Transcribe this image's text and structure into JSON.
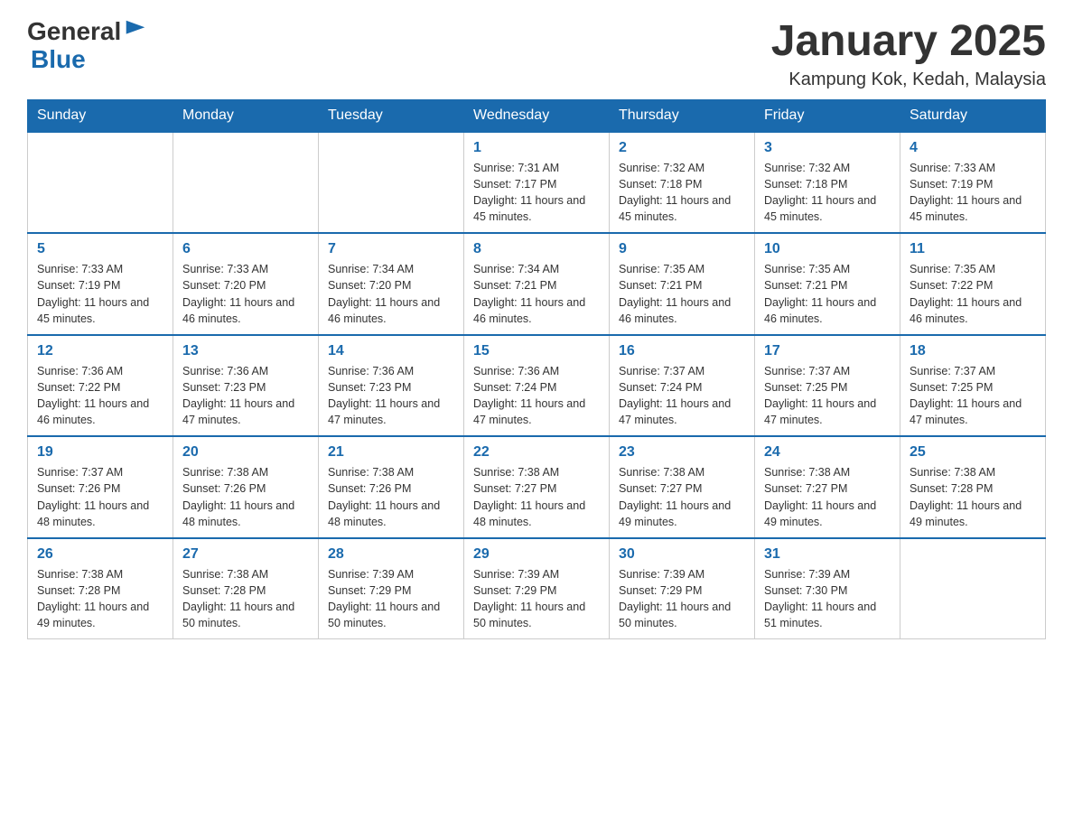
{
  "header": {
    "logo_general": "General",
    "logo_blue": "Blue",
    "month_title": "January 2025",
    "location": "Kampung Kok, Kedah, Malaysia"
  },
  "calendar": {
    "days_of_week": [
      "Sunday",
      "Monday",
      "Tuesday",
      "Wednesday",
      "Thursday",
      "Friday",
      "Saturday"
    ],
    "weeks": [
      [
        {
          "day": "",
          "info": ""
        },
        {
          "day": "",
          "info": ""
        },
        {
          "day": "",
          "info": ""
        },
        {
          "day": "1",
          "info": "Sunrise: 7:31 AM\nSunset: 7:17 PM\nDaylight: 11 hours and 45 minutes."
        },
        {
          "day": "2",
          "info": "Sunrise: 7:32 AM\nSunset: 7:18 PM\nDaylight: 11 hours and 45 minutes."
        },
        {
          "day": "3",
          "info": "Sunrise: 7:32 AM\nSunset: 7:18 PM\nDaylight: 11 hours and 45 minutes."
        },
        {
          "day": "4",
          "info": "Sunrise: 7:33 AM\nSunset: 7:19 PM\nDaylight: 11 hours and 45 minutes."
        }
      ],
      [
        {
          "day": "5",
          "info": "Sunrise: 7:33 AM\nSunset: 7:19 PM\nDaylight: 11 hours and 45 minutes."
        },
        {
          "day": "6",
          "info": "Sunrise: 7:33 AM\nSunset: 7:20 PM\nDaylight: 11 hours and 46 minutes."
        },
        {
          "day": "7",
          "info": "Sunrise: 7:34 AM\nSunset: 7:20 PM\nDaylight: 11 hours and 46 minutes."
        },
        {
          "day": "8",
          "info": "Sunrise: 7:34 AM\nSunset: 7:21 PM\nDaylight: 11 hours and 46 minutes."
        },
        {
          "day": "9",
          "info": "Sunrise: 7:35 AM\nSunset: 7:21 PM\nDaylight: 11 hours and 46 minutes."
        },
        {
          "day": "10",
          "info": "Sunrise: 7:35 AM\nSunset: 7:21 PM\nDaylight: 11 hours and 46 minutes."
        },
        {
          "day": "11",
          "info": "Sunrise: 7:35 AM\nSunset: 7:22 PM\nDaylight: 11 hours and 46 minutes."
        }
      ],
      [
        {
          "day": "12",
          "info": "Sunrise: 7:36 AM\nSunset: 7:22 PM\nDaylight: 11 hours and 46 minutes."
        },
        {
          "day": "13",
          "info": "Sunrise: 7:36 AM\nSunset: 7:23 PM\nDaylight: 11 hours and 47 minutes."
        },
        {
          "day": "14",
          "info": "Sunrise: 7:36 AM\nSunset: 7:23 PM\nDaylight: 11 hours and 47 minutes."
        },
        {
          "day": "15",
          "info": "Sunrise: 7:36 AM\nSunset: 7:24 PM\nDaylight: 11 hours and 47 minutes."
        },
        {
          "day": "16",
          "info": "Sunrise: 7:37 AM\nSunset: 7:24 PM\nDaylight: 11 hours and 47 minutes."
        },
        {
          "day": "17",
          "info": "Sunrise: 7:37 AM\nSunset: 7:25 PM\nDaylight: 11 hours and 47 minutes."
        },
        {
          "day": "18",
          "info": "Sunrise: 7:37 AM\nSunset: 7:25 PM\nDaylight: 11 hours and 47 minutes."
        }
      ],
      [
        {
          "day": "19",
          "info": "Sunrise: 7:37 AM\nSunset: 7:26 PM\nDaylight: 11 hours and 48 minutes."
        },
        {
          "day": "20",
          "info": "Sunrise: 7:38 AM\nSunset: 7:26 PM\nDaylight: 11 hours and 48 minutes."
        },
        {
          "day": "21",
          "info": "Sunrise: 7:38 AM\nSunset: 7:26 PM\nDaylight: 11 hours and 48 minutes."
        },
        {
          "day": "22",
          "info": "Sunrise: 7:38 AM\nSunset: 7:27 PM\nDaylight: 11 hours and 48 minutes."
        },
        {
          "day": "23",
          "info": "Sunrise: 7:38 AM\nSunset: 7:27 PM\nDaylight: 11 hours and 49 minutes."
        },
        {
          "day": "24",
          "info": "Sunrise: 7:38 AM\nSunset: 7:27 PM\nDaylight: 11 hours and 49 minutes."
        },
        {
          "day": "25",
          "info": "Sunrise: 7:38 AM\nSunset: 7:28 PM\nDaylight: 11 hours and 49 minutes."
        }
      ],
      [
        {
          "day": "26",
          "info": "Sunrise: 7:38 AM\nSunset: 7:28 PM\nDaylight: 11 hours and 49 minutes."
        },
        {
          "day": "27",
          "info": "Sunrise: 7:38 AM\nSunset: 7:28 PM\nDaylight: 11 hours and 50 minutes."
        },
        {
          "day": "28",
          "info": "Sunrise: 7:39 AM\nSunset: 7:29 PM\nDaylight: 11 hours and 50 minutes."
        },
        {
          "day": "29",
          "info": "Sunrise: 7:39 AM\nSunset: 7:29 PM\nDaylight: 11 hours and 50 minutes."
        },
        {
          "day": "30",
          "info": "Sunrise: 7:39 AM\nSunset: 7:29 PM\nDaylight: 11 hours and 50 minutes."
        },
        {
          "day": "31",
          "info": "Sunrise: 7:39 AM\nSunset: 7:30 PM\nDaylight: 11 hours and 51 minutes."
        },
        {
          "day": "",
          "info": ""
        }
      ]
    ]
  }
}
